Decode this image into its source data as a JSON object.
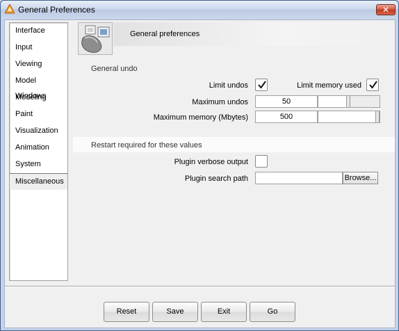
{
  "window": {
    "title": "General Preferences",
    "close_glyph": "✕"
  },
  "sidebar": {
    "items": [
      {
        "label": "Interface"
      },
      {
        "label": "Input"
      },
      {
        "label": "Viewing"
      },
      {
        "label": "Model Windows"
      },
      {
        "label": "Modeling"
      },
      {
        "label": "Paint"
      },
      {
        "label": "Visualization"
      },
      {
        "label": "Animation"
      },
      {
        "label": "System"
      },
      {
        "label": "Miscellaneous",
        "selected": true
      }
    ]
  },
  "header": {
    "title": "General preferences",
    "icon": "mouse-preferences-icon"
  },
  "general_undo": {
    "section_label": "General undo",
    "limit_undos_label": "Limit undos",
    "limit_undos_checked": true,
    "limit_memory_label": "Limit memory used",
    "limit_memory_checked": true,
    "max_undos_label": "Maximum undos",
    "max_undos_value": "50",
    "max_undos_slider_fraction": 0.45,
    "max_memory_label": "Maximum memory (Mbytes)",
    "max_memory_value": "500",
    "max_memory_slider_fraction": 1.0
  },
  "restart": {
    "section_label": "Restart required for these values",
    "plugin_verbose_label": "Plugin verbose output",
    "plugin_verbose_checked": false,
    "plugin_path_label": "Plugin search path",
    "plugin_path_value": "",
    "browse_label": "Browse..."
  },
  "footer": {
    "reset_label": "Reset",
    "save_label": "Save",
    "exit_label": "Exit",
    "go_label": "Go"
  },
  "colors": {
    "titlebar": "#ccd9ee",
    "close_button": "#c0391f",
    "panel_background": "#f0f0f0"
  }
}
